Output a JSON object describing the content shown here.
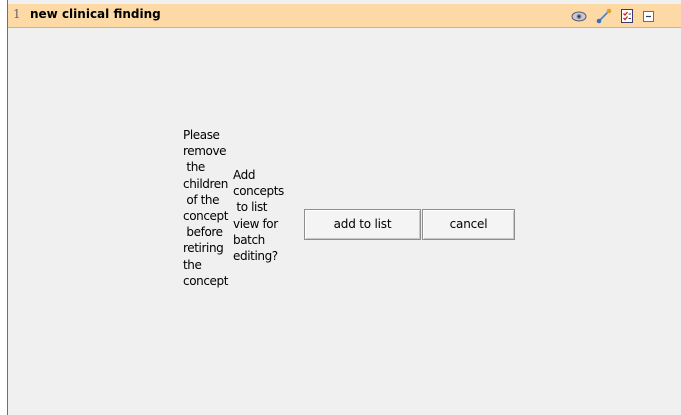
{
  "header": {
    "row_number": "1",
    "title": "new clinical finding",
    "icons": [
      "eye-icon",
      "link-icon",
      "checklist-icon",
      "collapse-icon"
    ]
  },
  "dialog": {
    "retire_message": "Please\nremove\n the\nchildren\n of the\nconcept\n before\nretiring\nthe\nconcept",
    "add_message": "Add\nconcepts\n to list\nview for\nbatch\nediting?",
    "add_button": "add to list",
    "cancel_button": "cancel"
  }
}
